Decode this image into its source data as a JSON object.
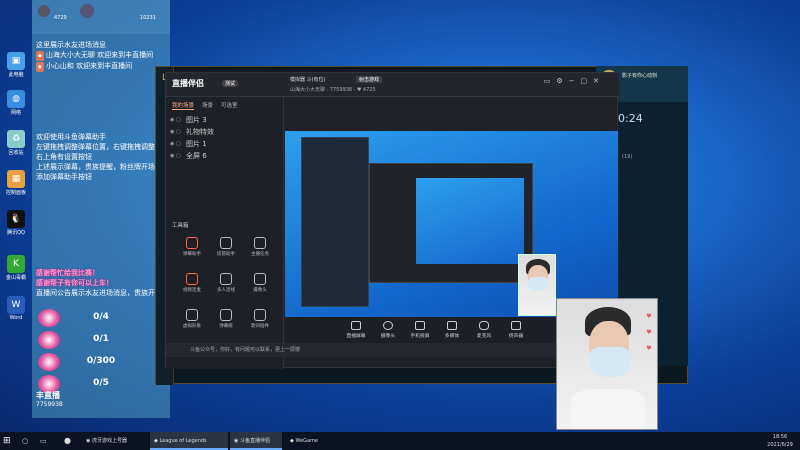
{
  "desktop": {
    "icons": [
      {
        "label": "此电脑"
      },
      {
        "label": "网络"
      },
      {
        "label": "回收站"
      },
      {
        "label": "控制面板"
      },
      {
        "label": "腾讯QQ"
      },
      {
        "label": "金山毒霸"
      },
      {
        "label": "Word"
      }
    ]
  },
  "chat": {
    "header": {
      "left_count": "4729",
      "right_count": "10231"
    },
    "messages": [
      "这里展示水友进场消息",
      "山海大小大无聊  欢迎来到丰直播间",
      "小心山和  欢迎来到丰直播间",
      "",
      "",
      "欢迎使用斗鱼弹幕助手",
      "左键拖拽调整弹幕位置，右键拖拽调整窗体大小",
      "右上角有设置按钮",
      "上述展示弹幕，贵族提醒，粉丝牌开场等",
      "添加弹幕助手按钮"
    ],
    "pink_lines": [
      "感谢帮忙给我比赛！",
      "感谢帮子有你可以上车！"
    ],
    "notice": "直播间公告展示水友进场消息，贵族开通",
    "tasks": [
      {
        "value": "0/4"
      },
      {
        "value": "0/1"
      },
      {
        "value": "0/300"
      },
      {
        "value": "0/5"
      }
    ],
    "footer_title": "丰直播",
    "footer_id": "7759938"
  },
  "live_app": {
    "logo": "直播伴侣",
    "badge": "测试",
    "title_text": "模拟器  斗(有位)",
    "search_label": "射击游戏",
    "room_name": "山海大小大无聊",
    "room_id": "7759938",
    "fans": "4725",
    "side_tabs": [
      "我的场景",
      "场景",
      "可选室"
    ],
    "scenes": [
      "图片 3",
      "礼物特效",
      "图片 1",
      "全屏 6"
    ],
    "tools_title": "工具箱",
    "tools": [
      "弹幕助手",
      "房管助手",
      "主播任务",
      "视频连麦",
      "多人连线",
      "摄像头",
      "虚拟形象",
      "弹幕姬",
      "歌词插件"
    ],
    "bottom_buttons": [
      "直播屏幕",
      "摄像头",
      "手机投屏",
      "多媒体",
      "麦克风",
      "扬声器"
    ],
    "status": "斗鱼公众号，你好，有问题可以联系，更上一层楼"
  },
  "lol_right": {
    "player": "影子有你心动刻",
    "clock": "0:24",
    "online": "(19)"
  },
  "taskbar": {
    "items": [
      {
        "label": "虎牙游戏上号器"
      },
      {
        "label": "League of Legends"
      },
      {
        "label": "斗鱼直播伴侣"
      },
      {
        "label": "WeGame"
      }
    ],
    "time": "18:56",
    "date": "2021/6/29"
  },
  "colors": {
    "accent": "#ff6a3d",
    "desktop": "#1a66c8",
    "chat_panel": "#6ab8cf"
  }
}
